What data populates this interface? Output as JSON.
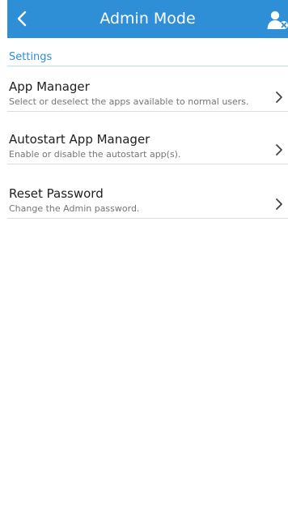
{
  "header": {
    "title": "Admin Mode",
    "back_icon": "chevron-left-icon",
    "admin_icon": "admin-user-icon",
    "bar_color": "#2e8ed6"
  },
  "section": {
    "title": "Settings"
  },
  "items": [
    {
      "title": "App Manager",
      "description": "Select or deselect the apps available to normal users."
    },
    {
      "title": "Autostart App Manager",
      "description": "Enable or disable the autostart app(s)."
    },
    {
      "title": "Reset Password",
      "description": "Change the Admin password."
    }
  ],
  "colors": {
    "accent": "#2e8ed6",
    "primary_text": "#212121",
    "secondary_text": "#757575"
  }
}
